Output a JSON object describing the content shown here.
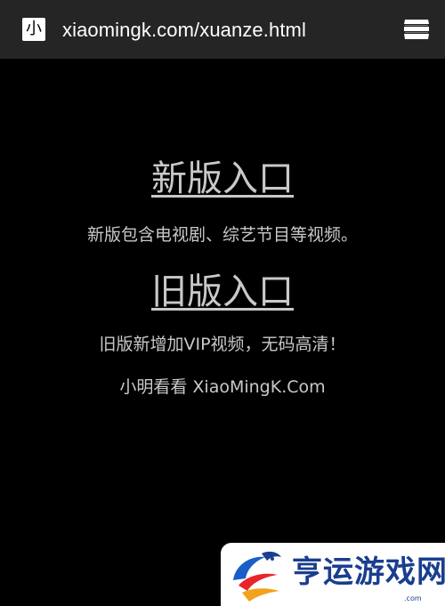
{
  "browser": {
    "favicon_char": "小",
    "url": "xiaomingk.com/xuanze.html",
    "menu_icon": "stack-menu-icon"
  },
  "main": {
    "new_entry_label": "新版入口",
    "new_entry_desc": "新版包含电视剧、综艺节目等视频。",
    "old_entry_label": "旧版入口",
    "old_entry_desc": "旧版新增加VIP视频，无码高清！",
    "footer_text": "小明看看 XiaoMingK.Com"
  },
  "watermark": {
    "text": "亨运游戏网",
    "sub": ".com"
  },
  "colors": {
    "background": "#000000",
    "topbar": "#252525",
    "text": "#c9c9c9",
    "watermark_text": "#1a3e8f"
  }
}
